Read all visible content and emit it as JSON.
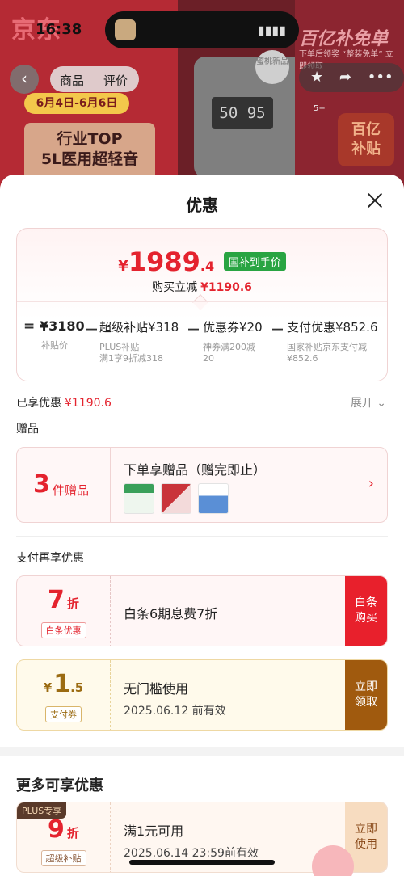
{
  "status_bar": {
    "time": "16:38"
  },
  "background_page": {
    "logo": "京东",
    "event_date": "6月4日-6月6日",
    "promo_line1": "行业TOP",
    "promo_line2": "5L医用超轻音",
    "device_display": "50 95",
    "right_title": "百亿补免单",
    "right_sub": "下单后领奖 “整装免单” 立即领取",
    "subsidy_badge_line1": "百亿",
    "subsidy_badge_line2": "补贴",
    "seal_text": "蜜桃新品",
    "nav": {
      "tab_product": "商品",
      "tab_review": "评价",
      "cart_count": "5+"
    }
  },
  "sheet": {
    "title": "优惠",
    "price": {
      "currency": "¥",
      "integer": "1989",
      "decimal": ".4",
      "tag": "国补到手价",
      "reduce_label": "购买立减",
      "reduce_amount": "¥1190.6"
    },
    "breakdown": [
      {
        "op": "=",
        "label": "¥3180",
        "sub1": "补贴价",
        "sub2": ""
      },
      {
        "op": "－",
        "label": "超级补贴¥318",
        "sub1": "PLUS补贴",
        "sub2": "满1享9折减318"
      },
      {
        "op": "－",
        "label": "优惠券¥20",
        "sub1": "神券满200减",
        "sub2": "20"
      },
      {
        "op": "－",
        "label": "支付优惠¥852.6",
        "sub1": "国家补贴京东支付减",
        "sub2": "¥852.6"
      }
    ],
    "enjoyed_label": "已享优惠",
    "enjoyed_amount": "¥1190.6",
    "expand_label": "展开",
    "gifts": {
      "section_title": "赠品",
      "count": "3",
      "unit": "件赠品",
      "title": "下单享赠品（赠完即止）"
    },
    "pay_section_title": "支付再享优惠",
    "coupons": [
      {
        "big": "7",
        "unit": "折",
        "badge": "白条优惠",
        "text": "白条6期息费7折",
        "button_line1": "白条",
        "button_line2": "购买"
      },
      {
        "prefix": "¥",
        "big": "1",
        "decimal": ".5",
        "badge": "支付券",
        "line1": "无门槛使用",
        "line2": "2025.06.12 前有效",
        "button_line1": "立即",
        "button_line2": "领取"
      }
    ],
    "more_title": "更多可享优惠",
    "plus_coupon": {
      "tag": "PLUS专享",
      "big": "9",
      "unit": "折",
      "badge": "超级补贴",
      "line1": "满1元可用",
      "line2": "2025.06.14 23:59前有效",
      "button_line1": "立即",
      "button_line2": "使用"
    }
  },
  "colors": {
    "accent_red": "#e4232e",
    "tag_green": "#29a442",
    "pay_red_button": "#e8202c",
    "brown_button": "#a05a0e",
    "peach_button": "#f7dcc0"
  }
}
